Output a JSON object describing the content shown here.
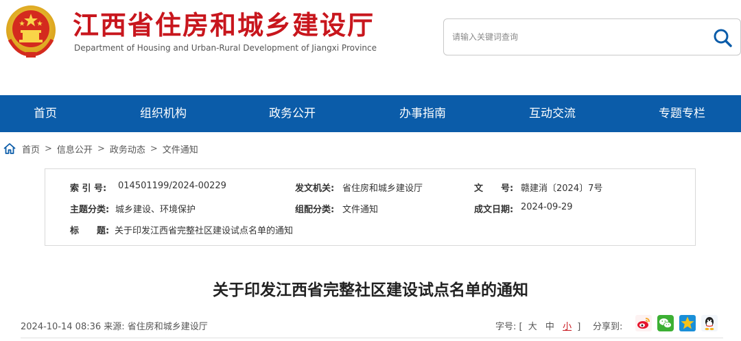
{
  "header": {
    "site_title": "江西省住房和城乡建设厅",
    "site_subtitle": "Department of Housing and Urban-Rural Development of Jiangxi Province",
    "search_placeholder": "请输入关键词查询"
  },
  "nav": {
    "items": [
      "首页",
      "组织机构",
      "政务公开",
      "办事指南",
      "互动交流",
      "专题专栏"
    ]
  },
  "breadcrumb": {
    "items": [
      "首页",
      "信息公开",
      "政务动态",
      "文件通知"
    ],
    "separator": ">"
  },
  "info": {
    "index_label": "索 引 号:",
    "index_value": "014501199/2024-00229",
    "issuer_label": "发文机关:",
    "issuer_value": "省住房和城乡建设厅",
    "docno_label": "文　　号:",
    "docno_value": "赣建消〔2024〕7号",
    "topic_label": "主题分类:",
    "topic_value": "城乡建设、环境保护",
    "category_label": "组配分类:",
    "category_value": "文件通知",
    "date_label": "成文日期:",
    "date_value": "2024-09-29",
    "title_label": "标　　题:",
    "title_value": "关于印发江西省完整社区建设试点名单的通知"
  },
  "article": {
    "title": "关于印发江西省完整社区建设试点名单的通知",
    "meta": "2024-10-14 08:36  来源:  省住房和城乡建设厅",
    "font_size_label": "字号:",
    "font_size_open": "[",
    "font_large": "大",
    "font_medium": "中",
    "font_small": "小",
    "font_size_close": "]",
    "share_label": "分享到:"
  },
  "colors": {
    "brand_red": "#c8161d",
    "nav_blue": "#0b5ca9"
  },
  "icons": {
    "emblem": "national-emblem-icon",
    "search": "search-icon",
    "home": "home-icon",
    "share": [
      "weibo-icon",
      "wechat-icon",
      "qzone-icon",
      "qq-icon"
    ]
  }
}
